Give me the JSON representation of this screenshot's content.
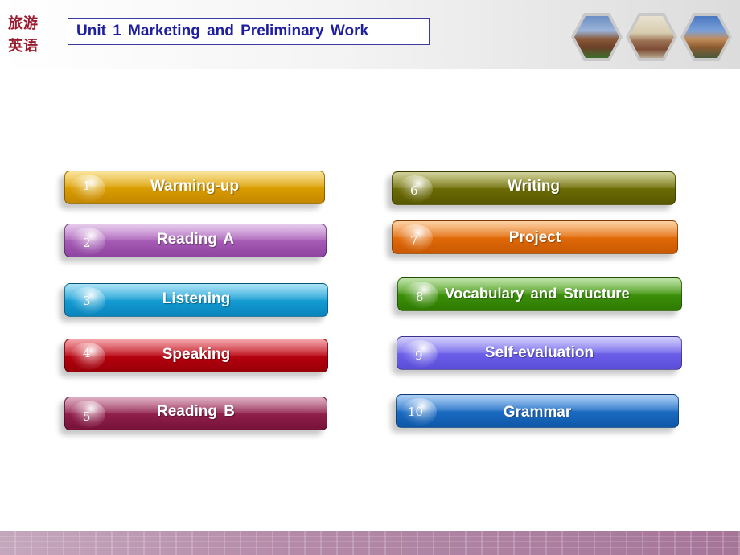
{
  "header": {
    "logo_line1": "旅游",
    "logo_line2": "英语",
    "unit_title": "Unit 1 Marketing and Preliminary Work",
    "photos": [
      "building-photo",
      "clock-tower-photo",
      "street-photo"
    ]
  },
  "menu": {
    "items": [
      {
        "number": "1",
        "label": "Warming-up",
        "color": "#d8a000"
      },
      {
        "number": "2",
        "label": "Reading A",
        "color": "#a45ab4"
      },
      {
        "number": "3",
        "label": "Listening",
        "color": "#129ad0"
      },
      {
        "number": "4",
        "label": "Speaking",
        "color": "#b4000e"
      },
      {
        "number": "5",
        "label": "Reading B",
        "color": "#8e1e4a"
      },
      {
        "number": "6",
        "label": "Writing",
        "color": "#6a6a04"
      },
      {
        "number": "7",
        "label": "Project",
        "color": "#e06808"
      },
      {
        "number": "8",
        "label": "Vocabulary and Structure",
        "color": "#3a8e08"
      },
      {
        "number": "9",
        "label": "Self-evaluation",
        "color": "#6a5ee8"
      },
      {
        "number": "10",
        "label": "Grammar",
        "color": "#1a6ac0"
      }
    ]
  }
}
